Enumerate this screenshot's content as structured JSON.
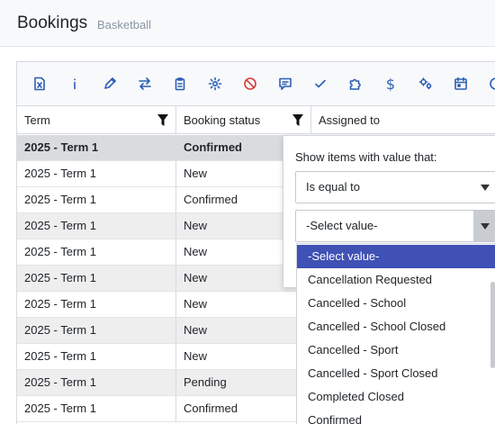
{
  "header": {
    "title": "Bookings",
    "subtitle": "Basketball"
  },
  "toolbar": {
    "icons": [
      "excel-icon",
      "info-icon",
      "edit-icon",
      "transfer-icon",
      "clipboard-icon",
      "settings-icon",
      "cancel-icon",
      "comment-icon",
      "check-icon",
      "puzzle-icon",
      "dollar-icon",
      "gears-icon",
      "calendar-icon",
      "clock-icon"
    ]
  },
  "table": {
    "columns": [
      "Term",
      "Booking status",
      "Assigned to"
    ],
    "rows": [
      {
        "term": "2025 - Term 1",
        "status": "Confirmed"
      },
      {
        "term": "2025 - Term 1",
        "status": "New"
      },
      {
        "term": "2025 - Term 1",
        "status": "Confirmed"
      },
      {
        "term": "2025 - Term 1",
        "status": "New"
      },
      {
        "term": "2025 - Term 1",
        "status": "New"
      },
      {
        "term": "2025 - Term 1",
        "status": "New"
      },
      {
        "term": "2025 - Term 1",
        "status": "New"
      },
      {
        "term": "2025 - Term 1",
        "status": "New"
      },
      {
        "term": "2025 - Term 1",
        "status": "New"
      },
      {
        "term": "2025 - Term 1",
        "status": "Pending"
      },
      {
        "term": "2025 - Term 1",
        "status": "Confirmed"
      }
    ]
  },
  "filter": {
    "label": "Show items with value that:",
    "operator": "Is equal to",
    "value_placeholder": "-Select value-",
    "options": [
      "-Select value-",
      "Cancellation Requested",
      "Cancelled - School",
      "Cancelled - School Closed",
      "Cancelled - Sport",
      "Cancelled - Sport Closed",
      "Completed Closed",
      "Confirmed"
    ]
  },
  "colors": {
    "accent": "#2b5fb4",
    "selected_option": "#3f51b5",
    "cancel_icon": "#d9383a"
  }
}
